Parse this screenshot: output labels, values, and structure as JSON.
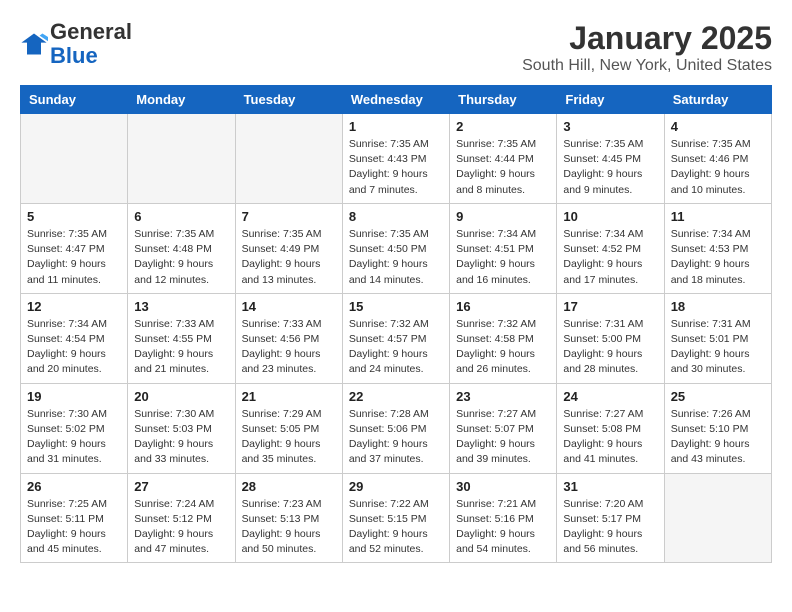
{
  "logo": {
    "general": "General",
    "blue": "Blue"
  },
  "title": "January 2025",
  "subtitle": "South Hill, New York, United States",
  "headers": [
    "Sunday",
    "Monday",
    "Tuesday",
    "Wednesday",
    "Thursday",
    "Friday",
    "Saturday"
  ],
  "weeks": [
    [
      {
        "num": "",
        "info": ""
      },
      {
        "num": "",
        "info": ""
      },
      {
        "num": "",
        "info": ""
      },
      {
        "num": "1",
        "info": "Sunrise: 7:35 AM\nSunset: 4:43 PM\nDaylight: 9 hours\nand 7 minutes."
      },
      {
        "num": "2",
        "info": "Sunrise: 7:35 AM\nSunset: 4:44 PM\nDaylight: 9 hours\nand 8 minutes."
      },
      {
        "num": "3",
        "info": "Sunrise: 7:35 AM\nSunset: 4:45 PM\nDaylight: 9 hours\nand 9 minutes."
      },
      {
        "num": "4",
        "info": "Sunrise: 7:35 AM\nSunset: 4:46 PM\nDaylight: 9 hours\nand 10 minutes."
      }
    ],
    [
      {
        "num": "5",
        "info": "Sunrise: 7:35 AM\nSunset: 4:47 PM\nDaylight: 9 hours\nand 11 minutes."
      },
      {
        "num": "6",
        "info": "Sunrise: 7:35 AM\nSunset: 4:48 PM\nDaylight: 9 hours\nand 12 minutes."
      },
      {
        "num": "7",
        "info": "Sunrise: 7:35 AM\nSunset: 4:49 PM\nDaylight: 9 hours\nand 13 minutes."
      },
      {
        "num": "8",
        "info": "Sunrise: 7:35 AM\nSunset: 4:50 PM\nDaylight: 9 hours\nand 14 minutes."
      },
      {
        "num": "9",
        "info": "Sunrise: 7:34 AM\nSunset: 4:51 PM\nDaylight: 9 hours\nand 16 minutes."
      },
      {
        "num": "10",
        "info": "Sunrise: 7:34 AM\nSunset: 4:52 PM\nDaylight: 9 hours\nand 17 minutes."
      },
      {
        "num": "11",
        "info": "Sunrise: 7:34 AM\nSunset: 4:53 PM\nDaylight: 9 hours\nand 18 minutes."
      }
    ],
    [
      {
        "num": "12",
        "info": "Sunrise: 7:34 AM\nSunset: 4:54 PM\nDaylight: 9 hours\nand 20 minutes."
      },
      {
        "num": "13",
        "info": "Sunrise: 7:33 AM\nSunset: 4:55 PM\nDaylight: 9 hours\nand 21 minutes."
      },
      {
        "num": "14",
        "info": "Sunrise: 7:33 AM\nSunset: 4:56 PM\nDaylight: 9 hours\nand 23 minutes."
      },
      {
        "num": "15",
        "info": "Sunrise: 7:32 AM\nSunset: 4:57 PM\nDaylight: 9 hours\nand 24 minutes."
      },
      {
        "num": "16",
        "info": "Sunrise: 7:32 AM\nSunset: 4:58 PM\nDaylight: 9 hours\nand 26 minutes."
      },
      {
        "num": "17",
        "info": "Sunrise: 7:31 AM\nSunset: 5:00 PM\nDaylight: 9 hours\nand 28 minutes."
      },
      {
        "num": "18",
        "info": "Sunrise: 7:31 AM\nSunset: 5:01 PM\nDaylight: 9 hours\nand 30 minutes."
      }
    ],
    [
      {
        "num": "19",
        "info": "Sunrise: 7:30 AM\nSunset: 5:02 PM\nDaylight: 9 hours\nand 31 minutes."
      },
      {
        "num": "20",
        "info": "Sunrise: 7:30 AM\nSunset: 5:03 PM\nDaylight: 9 hours\nand 33 minutes."
      },
      {
        "num": "21",
        "info": "Sunrise: 7:29 AM\nSunset: 5:05 PM\nDaylight: 9 hours\nand 35 minutes."
      },
      {
        "num": "22",
        "info": "Sunrise: 7:28 AM\nSunset: 5:06 PM\nDaylight: 9 hours\nand 37 minutes."
      },
      {
        "num": "23",
        "info": "Sunrise: 7:27 AM\nSunset: 5:07 PM\nDaylight: 9 hours\nand 39 minutes."
      },
      {
        "num": "24",
        "info": "Sunrise: 7:27 AM\nSunset: 5:08 PM\nDaylight: 9 hours\nand 41 minutes."
      },
      {
        "num": "25",
        "info": "Sunrise: 7:26 AM\nSunset: 5:10 PM\nDaylight: 9 hours\nand 43 minutes."
      }
    ],
    [
      {
        "num": "26",
        "info": "Sunrise: 7:25 AM\nSunset: 5:11 PM\nDaylight: 9 hours\nand 45 minutes."
      },
      {
        "num": "27",
        "info": "Sunrise: 7:24 AM\nSunset: 5:12 PM\nDaylight: 9 hours\nand 47 minutes."
      },
      {
        "num": "28",
        "info": "Sunrise: 7:23 AM\nSunset: 5:13 PM\nDaylight: 9 hours\nand 50 minutes."
      },
      {
        "num": "29",
        "info": "Sunrise: 7:22 AM\nSunset: 5:15 PM\nDaylight: 9 hours\nand 52 minutes."
      },
      {
        "num": "30",
        "info": "Sunrise: 7:21 AM\nSunset: 5:16 PM\nDaylight: 9 hours\nand 54 minutes."
      },
      {
        "num": "31",
        "info": "Sunrise: 7:20 AM\nSunset: 5:17 PM\nDaylight: 9 hours\nand 56 minutes."
      },
      {
        "num": "",
        "info": ""
      }
    ]
  ]
}
